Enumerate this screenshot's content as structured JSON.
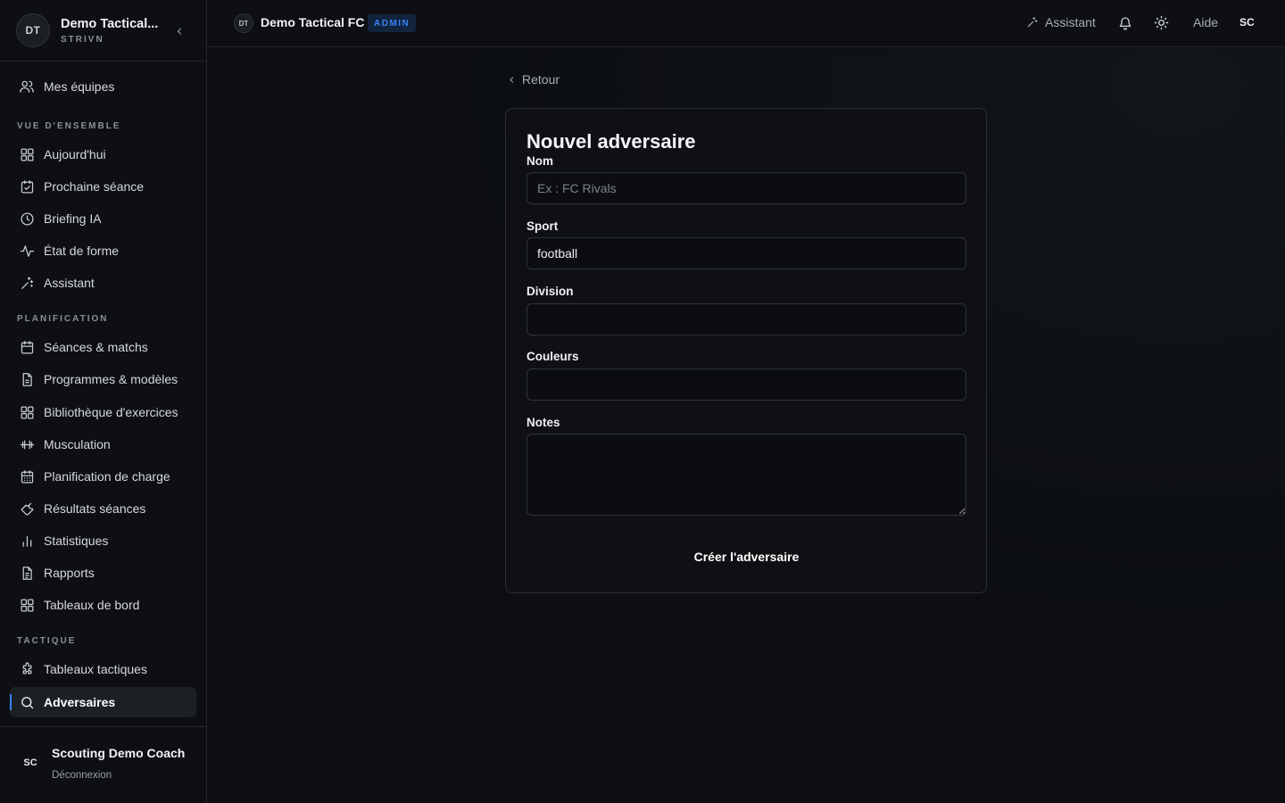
{
  "sidebar": {
    "org_initials": "DT",
    "org_name": "Demo Tactical...",
    "org_sub": "STRIVN",
    "top_item": {
      "label": "Mes équipes",
      "icon": "users-icon"
    },
    "sections": [
      {
        "label": "VUE D'ENSEMBLE"
      },
      {
        "label": "PLANIFICATION"
      },
      {
        "label": "TACTIQUE"
      }
    ],
    "items": [
      {
        "label": "Aujourd'hui",
        "icon": "grid-icon"
      },
      {
        "label": "Prochaine séance",
        "icon": "calendar-check-icon"
      },
      {
        "label": "Briefing IA",
        "icon": "clock-icon"
      },
      {
        "label": "État de forme",
        "icon": "activity-icon"
      },
      {
        "label": "Assistant",
        "icon": "sparkles-icon"
      },
      {
        "label": "Séances & matchs",
        "icon": "calendar-icon"
      },
      {
        "label": "Programmes & modèles",
        "icon": "file-icon"
      },
      {
        "label": "Bibliothèque d'exercices",
        "icon": "grid-icon"
      },
      {
        "label": "Musculation",
        "icon": "dumbbell-icon"
      },
      {
        "label": "Planification de charge",
        "icon": "calendar-grid-icon"
      },
      {
        "label": "Résultats séances",
        "icon": "wrench-icon"
      },
      {
        "label": "Statistiques",
        "icon": "bar-chart-icon"
      },
      {
        "label": "Rapports",
        "icon": "file-text-icon"
      },
      {
        "label": "Tableaux de bord",
        "icon": "grid-icon"
      },
      {
        "label": "Tableaux tactiques",
        "icon": "puzzle-icon"
      },
      {
        "label": "Adversaires",
        "icon": "search-icon"
      }
    ],
    "user_initials": "SC",
    "user_name": "Scouting Demo Coach",
    "logout": "Déconnexion"
  },
  "topbar": {
    "team_initials": "DT",
    "team_name": "Demo Tactical FC",
    "badge": "ADMIN",
    "assistant": "Assistant",
    "help": "Aide",
    "user_initials": "SC"
  },
  "main": {
    "back": "Retour",
    "form": {
      "title": "Nouvel adversaire",
      "name_label": "Nom",
      "name_placeholder": "Ex : FC Rivals",
      "name_value": "",
      "sport_label": "Sport",
      "sport_value": "football",
      "division_label": "Division",
      "division_value": "",
      "colors_label": "Couleurs",
      "colors_value": "",
      "notes_label": "Notes",
      "notes_value": "",
      "submit": "Créer l'adversaire"
    }
  },
  "colors": {
    "accent": "#3b82f6",
    "background": "#0c0e11",
    "border": "#24272c"
  }
}
